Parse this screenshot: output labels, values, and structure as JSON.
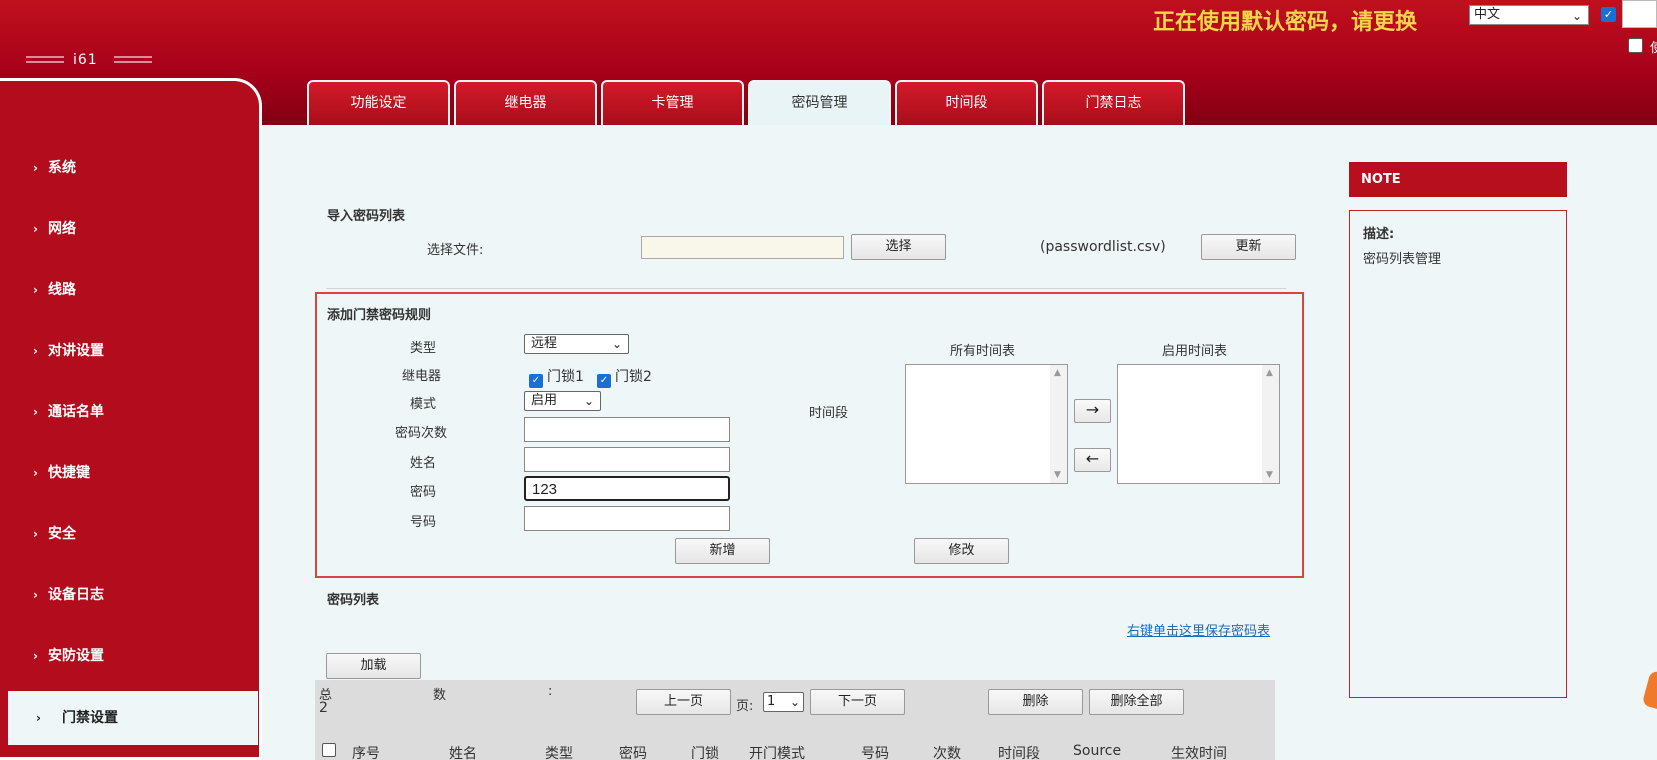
{
  "header": {
    "logo_text": "i61",
    "warning": "正在使用默认密码，请更换",
    "language": "中文",
    "small_text": "使"
  },
  "tabs": [
    "功能设定",
    "继电器",
    "卡管理",
    "密码管理",
    "时间段",
    "门禁日志"
  ],
  "active_tab": "密码管理",
  "sidebar": {
    "items": [
      "系统",
      "网络",
      "线路",
      "对讲设置",
      "通话名单",
      "快捷键",
      "安全",
      "设备日志",
      "安防设置",
      "门禁设置"
    ],
    "active": "门禁设置"
  },
  "import": {
    "title": "导入密码列表",
    "file_label": "选择文件:",
    "select_button": "选择",
    "filename_hint": "(passwordlist.csv)",
    "update_button": "更新"
  },
  "rule": {
    "title": "添加门禁密码规则",
    "type_label": "类型",
    "type_value": "远程",
    "relay_label": "继电器",
    "relay1": "门锁1",
    "relay2": "门锁2",
    "mode_label": "模式",
    "mode_value": "启用",
    "count_label": "密码次数",
    "count_value": "",
    "name_label": "姓名",
    "name_value": "",
    "password_label": "密码",
    "password_value": "123",
    "number_label": "号码",
    "number_value": "",
    "timeslot_label": "时间段",
    "all_schedules": "所有时间表",
    "enabled_schedules": "启用时间表",
    "move_right": "→",
    "move_left": "←",
    "add_button": "新增",
    "modify_button": "修改"
  },
  "list": {
    "title": "密码列表",
    "save_link": "右键单击这里保存密码表",
    "load_button": "加载",
    "total_label": "总",
    "total_value": "2",
    "count_label": "数",
    "colon": ":",
    "prev_button": "上一页",
    "page_label": "页:",
    "page_value": "1",
    "next_button": "下一页",
    "delete_button": "删除",
    "delete_all_button": "删除全部",
    "columns": [
      "序号",
      "姓名",
      "类型",
      "密码",
      "门锁",
      "开门模式",
      "号码",
      "次数",
      "时间段",
      "Source",
      "生效时间"
    ]
  },
  "note": {
    "header": "NOTE",
    "title": "描述:",
    "desc": "密码列表管理"
  }
}
